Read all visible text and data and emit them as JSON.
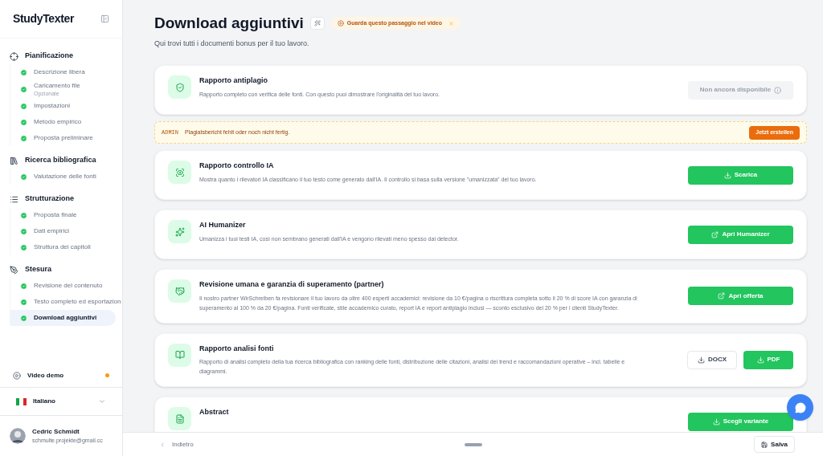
{
  "sidebar": {
    "brand": "StudyTexter",
    "groups": [
      {
        "title": "Pianificazione",
        "items": [
          {
            "label": "Descrizione libera",
            "done": true,
            "selected": false
          },
          {
            "label": "Caricamento file",
            "note": "Opzionale",
            "done": true,
            "selected": false
          },
          {
            "label": "Impostazioni",
            "done": true,
            "selected": false
          },
          {
            "label": "Metodo empirico",
            "done": true,
            "selected": false
          },
          {
            "label": "Proposta preliminare",
            "done": true,
            "selected": false
          }
        ]
      },
      {
        "title": "Ricerca bibliografica",
        "items": [
          {
            "label": "Valutazione delle fonti",
            "done": true,
            "selected": false
          }
        ]
      },
      {
        "title": "Strutturazione",
        "items": [
          {
            "label": "Proposta finale",
            "done": true,
            "selected": false
          },
          {
            "label": "Dati empirici",
            "done": true,
            "selected": false
          },
          {
            "label": "Struttura dei capitoli",
            "done": true,
            "selected": false
          }
        ]
      },
      {
        "title": "Stesura",
        "items": [
          {
            "label": "Revisione del contenuto",
            "done": true,
            "selected": false
          },
          {
            "label": "Testo completo ed esportazion",
            "done": true,
            "selected": false
          },
          {
            "label": "Download aggiuntivi",
            "done": true,
            "selected": true
          }
        ]
      }
    ],
    "video_demo": {
      "label": "Video demo",
      "unseen": true
    },
    "language": "Italiano",
    "user": {
      "name": "Cedric Schmidt",
      "email": "schmulte.projekte@gmail.cc"
    }
  },
  "page": {
    "title": "Download aggiuntivi",
    "video_hint": "Guarda questo passaggio nel video",
    "subtitle": "Qui trovi tutti i documenti bonus per il tuo lavoro."
  },
  "cards": [
    {
      "kind": "card",
      "title": "Rapporto antiplagio",
      "text": "Rapporto completo con verifica delle fonti. Con questo puoi dimostrare l'originalità del tuo lavoro.",
      "actions": [
        {
          "kind": "unavailable",
          "label": "Non ancora disponibile"
        }
      ]
    },
    {
      "kind": "notice",
      "tag": "ADMIN",
      "text": "Plagiatsbericht fehlt oder noch nicht fertig.",
      "action": "Jetzt erstellen"
    },
    {
      "kind": "card",
      "title": "Rapporto controllo IA",
      "text": "Mostra quanto i rilevatori IA classificano il tuo testo come generato dall'IA. Il controllo si basa sulla versione \"umanizzata\" del tuo lavoro.",
      "actions": [
        {
          "kind": "download",
          "primary": true,
          "label": "Scarica"
        }
      ]
    },
    {
      "kind": "card",
      "title": "AI Humanizer",
      "text": "Umanizza i tuoi testi IA, così non sembrano generati dall'IA e vengono rilevati meno spesso dai detector.",
      "actions": [
        {
          "kind": "link",
          "primary": true,
          "label": "Apri Humanizer"
        }
      ]
    },
    {
      "kind": "card",
      "title": "Revisione umana e garanzia di superamento (partner)",
      "text": "Il nostro partner WirSchreiben fa revisionare il tuo lavoro da oltre 400 esperti accademici: revisione da 10 €/pagina o riscrittura completa sotto il 20 % di score IA con garanzia di superamento al 100 % da 20 €/pagina. Fonti verificate, stile accademico curato, report IA e report antiplagio inclusi — sconto esclusivo del 20 % per i clienti StudyTexter.",
      "actions": [
        {
          "kind": "link",
          "primary": true,
          "label": "Apri offerta"
        }
      ]
    },
    {
      "kind": "card",
      "title": "Rapporto analisi fonti",
      "text": "Rapporto di analisi completo della tua ricerca bibliografica con ranking delle fonti, distribuzione delle citazioni, analisi dei trend e raccomandazioni operative – incl. tabelle e diagrammi.",
      "actions": [
        {
          "kind": "download",
          "primary": false,
          "label": "DOCX"
        },
        {
          "kind": "download",
          "primary": true,
          "label": "PDF"
        }
      ]
    },
    {
      "kind": "card",
      "title": "Abstract",
      "actions": [
        {
          "kind": "download",
          "primary": true,
          "label": "Scegli variante"
        }
      ]
    }
  ],
  "footer": {
    "back": "Indietro",
    "save": "Salva"
  }
}
